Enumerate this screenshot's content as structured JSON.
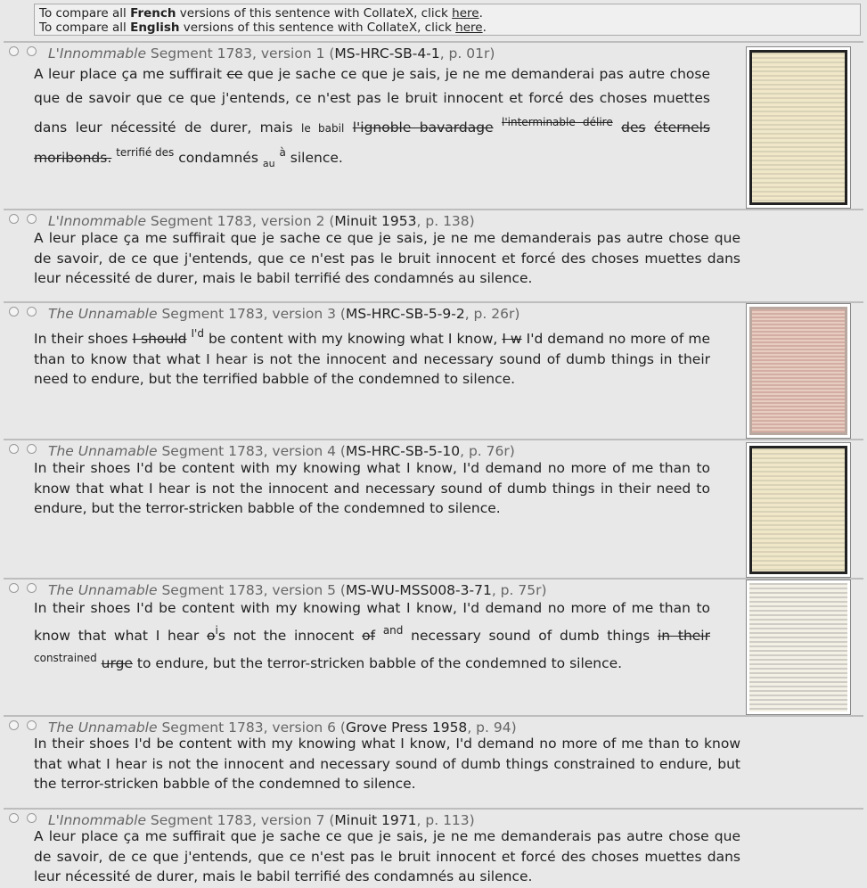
{
  "compare": {
    "french": {
      "prefix": "To compare all ",
      "lang": "French",
      "mid": " versions of this sentence with CollateX, click ",
      "link": "here",
      "end": "."
    },
    "english": {
      "prefix": "To compare all ",
      "lang": "English",
      "mid": " versions of this sentence with CollateX, click ",
      "link": "here",
      "end": "."
    }
  },
  "segments": [
    {
      "title": "L'Innommable",
      "meta": " Segment 1783, version 1 (",
      "siglum": "MS-HRC-SB-4-1",
      "page": ", p. 01r)",
      "thumb_style": "cream",
      "tokens": [
        "A leur place ça me suffirait ",
        "ce",
        " que je sache ce que je sais, je ne me demanderai pas autre chose que de savoir que ce que j'entends, ce n'est pas le bruit innocent et forcé des choses muettes dans leur nécessité de durer, mais ",
        "le babil",
        " ",
        "l'ignoble bavardage",
        " ",
        "l'interminable délire",
        " ",
        "des",
        " ",
        "éternels moribonds.",
        " ",
        "terrifié des",
        " condamnés ",
        "au",
        " ",
        "à",
        " silence."
      ]
    },
    {
      "title": "L'Innommable",
      "meta": " Segment 1783, version 2 (",
      "siglum": "Minuit 1953",
      "page": ", p. 138)",
      "text": "A leur place ça me suffirait que je sache ce que je sais, je ne me demanderais pas autre chose que de savoir, de ce que j'entends, que ce n'est pas le bruit innocent et forcé des choses muettes dans leur nécessité de durer, mais le babil terrifié des condamnés au silence."
    },
    {
      "title": "The Unnamable",
      "meta": " Segment 1783, version 3 (",
      "siglum": "MS-HRC-SB-5-9-2",
      "page": ", p. 26r)",
      "thumb_style": "pink",
      "tokens": [
        "In their shoes ",
        "I should",
        " ",
        "I'd",
        " be content with my knowing what I know, ",
        "I w",
        " I'd demand no more of me than to know that what I hear is not the innocent and necessary sound of dumb things in their need to endure, but the terrified babble of the condemned to silence."
      ]
    },
    {
      "title": "The Unnamable",
      "meta": " Segment 1783, version 4 (",
      "siglum": "MS-HRC-SB-5-10",
      "page": ", p. 76r)",
      "thumb_style": "cream",
      "text": "In their shoes I'd be content with my knowing what I know, I'd demand no more of me than to know that what I hear is not the innocent and necessary sound of dumb things in their need to endure, but the terror-stricken babble of the condemned to silence."
    },
    {
      "title": "The Unnamable",
      "meta": " Segment 1783, version 5 (",
      "siglum": "MS-WU-MSS008-3-71",
      "page": ", p. 75r)",
      "thumb_style": "white",
      "tokens": [
        "In their shoes I'd be content with my knowing what I know, I'd demand no more of me than to know that what I hear ",
        "o",
        "i",
        "s not the innocent ",
        "of",
        " ",
        "and",
        " necessary sound of dumb things ",
        "in their",
        " ",
        "constrained",
        " ",
        "urge",
        " to endure, but the terror-stricken babble of the condemned to silence."
      ]
    },
    {
      "title": "The Unnamable",
      "meta": " Segment 1783, version 6 (",
      "siglum": "Grove Press 1958",
      "page": ", p. 94)",
      "text": "In their shoes I'd be content with my knowing what I know, I'd demand no more of me than to know that what I hear is not the innocent and necessary sound of dumb things constrained to endure, but the terror-stricken babble of the condemned to silence."
    },
    {
      "title": "L'Innommable",
      "meta": " Segment 1783, version 7 (",
      "siglum": "Minuit 1971",
      "page": ", p. 113)",
      "text": "A leur place ça me suffirait que je sache ce que je sais, je ne me demanderais pas autre chose que de savoir, de ce que j'entends, que ce n'est pas le bruit innocent et forcé des choses muettes dans leur nécessité de durer, mais le babil terrifié des condamnés au silence."
    }
  ]
}
